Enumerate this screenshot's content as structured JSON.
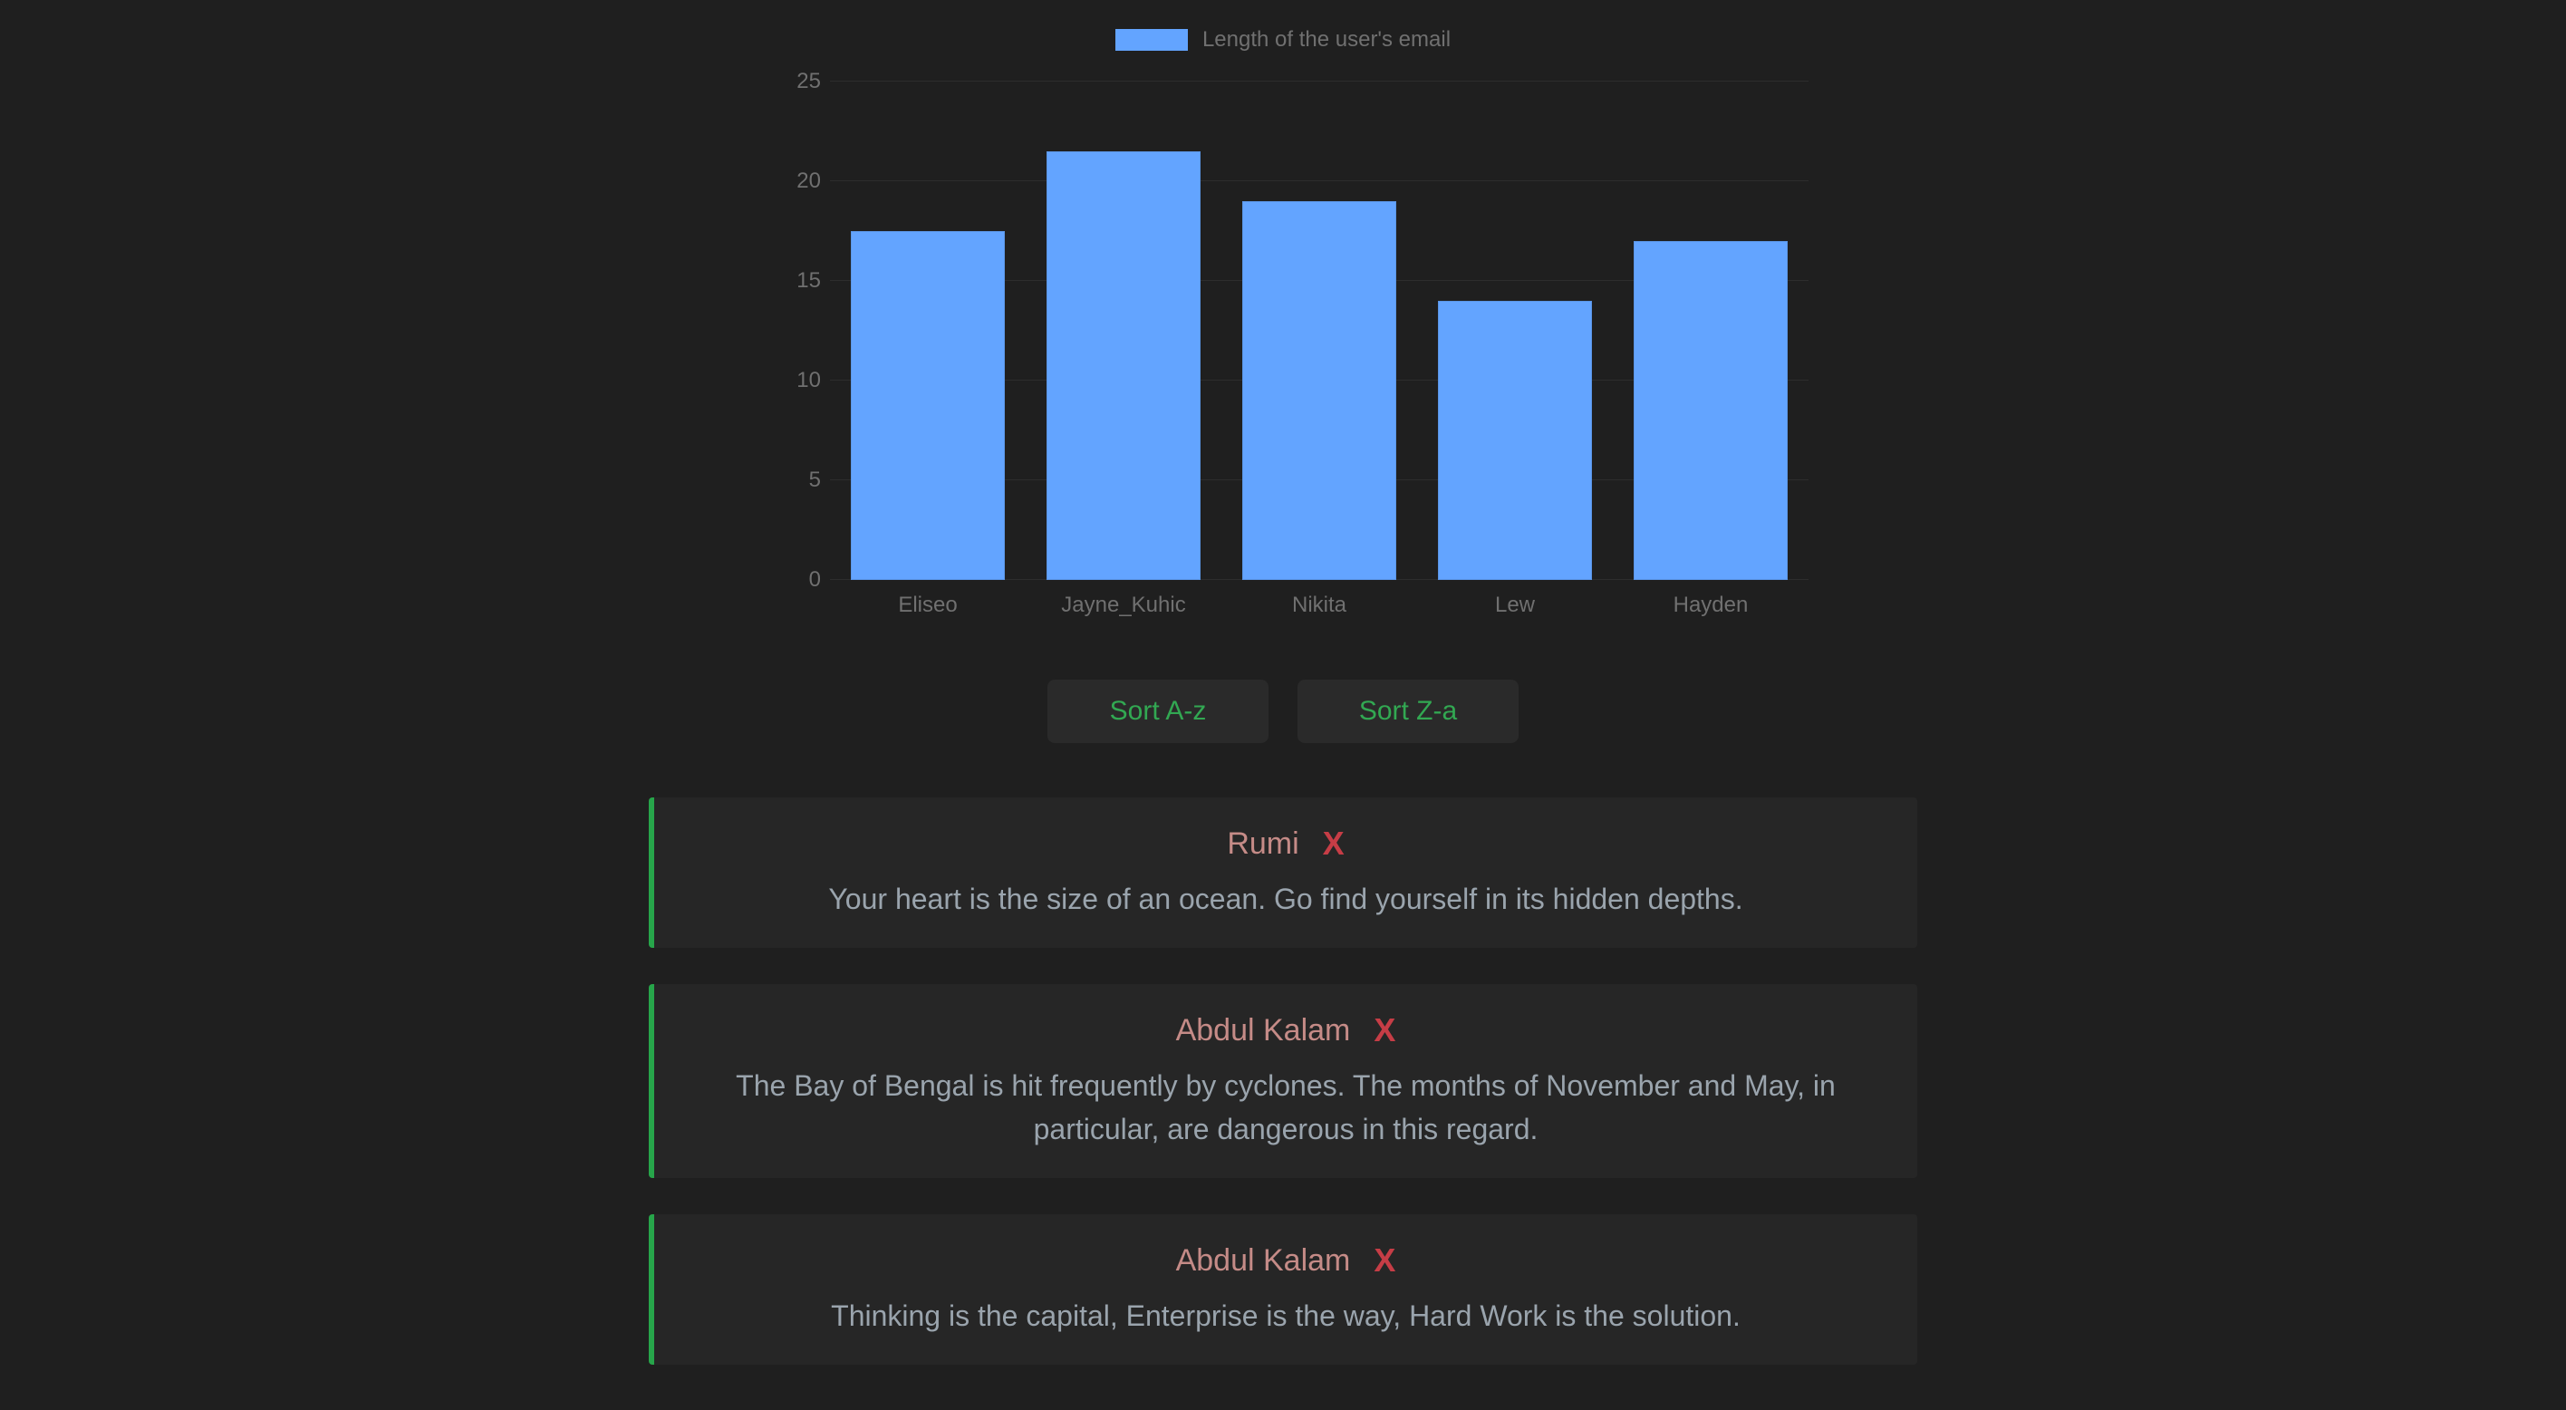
{
  "legend_label": "Length of the user's email",
  "sort_asc": "Sort A-z",
  "sort_desc": "Sort Z-a",
  "y_ticks": [
    0,
    5,
    10,
    15,
    20,
    25
  ],
  "chart_data": {
    "type": "bar",
    "title": "Length of the user's email",
    "categories": [
      "Eliseo",
      "Jayne_Kuhic",
      "Nikita",
      "Lew",
      "Hayden"
    ],
    "values": [
      17.5,
      21.5,
      19,
      14,
      17
    ],
    "ylim": [
      0,
      25
    ],
    "color": "#63a4ff"
  },
  "quotes": [
    {
      "author": "Rumi",
      "close": "X",
      "text": "Your heart is the size of an ocean. Go find yourself in its hidden depths."
    },
    {
      "author": "Abdul Kalam",
      "close": "X",
      "text": "The Bay of Bengal is hit frequently by cyclones. The months of November and May, in particular, are dangerous in this regard."
    },
    {
      "author": "Abdul Kalam",
      "close": "X",
      "text": "Thinking is the capital, Enterprise is the way, Hard Work is the solution."
    }
  ]
}
